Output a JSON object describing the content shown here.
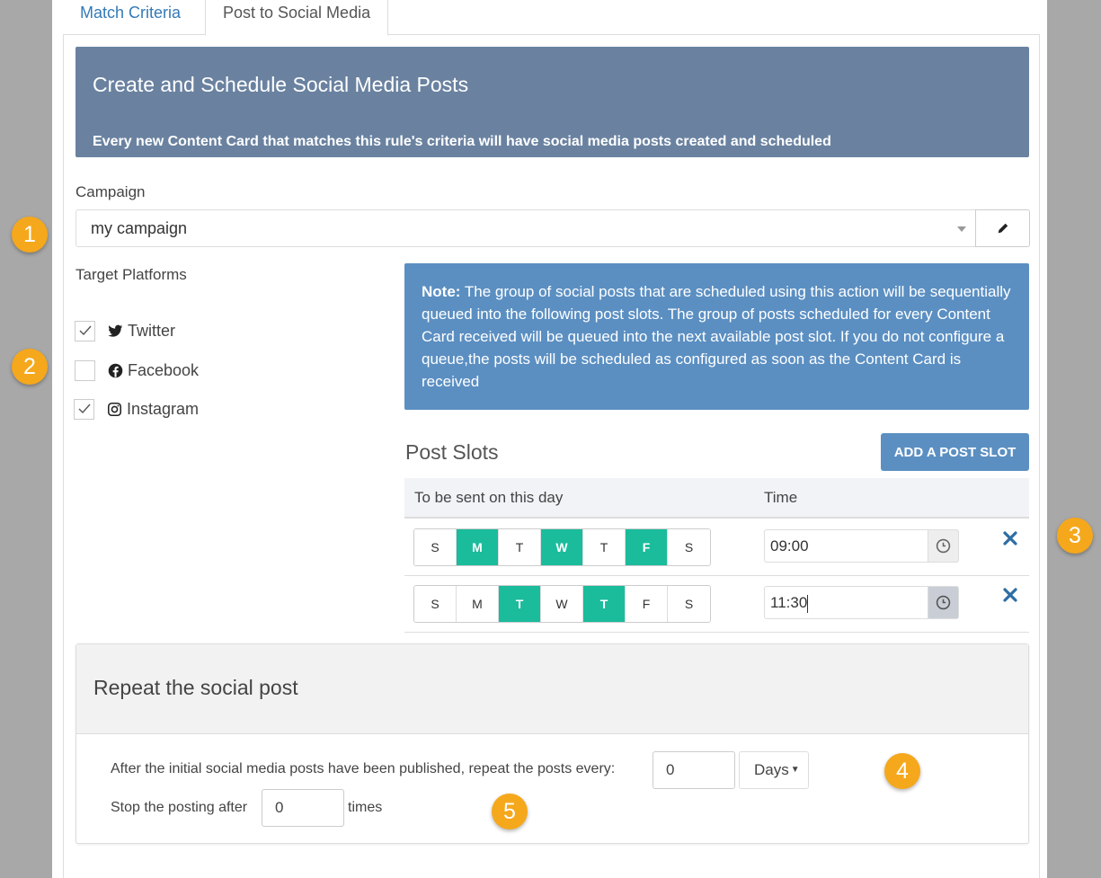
{
  "tabs": [
    {
      "label": "Match Criteria",
      "active": false
    },
    {
      "label": "Post to Social Media",
      "active": true
    }
  ],
  "banner": {
    "title": "Create and Schedule Social Media Posts",
    "subtitle": "Every new Content Card that matches this rule's criteria will have social media posts created and scheduled"
  },
  "campaign": {
    "label": "Campaign",
    "value": "my campaign"
  },
  "platforms": {
    "label": "Target Platforms",
    "items": [
      {
        "name": "Twitter",
        "checked": true,
        "icon": "twitter-icon"
      },
      {
        "name": "Facebook",
        "checked": false,
        "icon": "facebook-icon"
      },
      {
        "name": "Instagram",
        "checked": true,
        "icon": "instagram-icon"
      }
    ]
  },
  "note": {
    "prefix": "Note:",
    "text": " The group of social posts that are scheduled using this action will be sequentially queued into the following post slots. The group of posts scheduled for every Content Card received will be queued into the next available post slot. If you do not configure a queue,the posts will be scheduled as configured as soon as the Content Card is received"
  },
  "post_slots": {
    "title": "Post Slots",
    "add_label": "ADD A POST SLOT",
    "col_day": "To be sent on this day",
    "col_time": "Time",
    "rows": [
      {
        "days": [
          "S",
          "M",
          "T",
          "W",
          "T",
          "F",
          "S"
        ],
        "selected": [
          false,
          true,
          false,
          true,
          false,
          true,
          false
        ],
        "time": "09:00"
      },
      {
        "days": [
          "S",
          "M",
          "T",
          "W",
          "T",
          "F",
          "S"
        ],
        "selected": [
          false,
          false,
          true,
          false,
          true,
          false,
          false
        ],
        "time": "11:30"
      }
    ]
  },
  "repeat": {
    "title": "Repeat the social post",
    "repeat_text": "After the initial social media posts have been published, repeat the posts every:",
    "repeat_value": "0",
    "unit": "Days",
    "stop_text": "Stop the posting after",
    "stop_value": "0",
    "times_text": "times"
  },
  "markers": [
    "1",
    "2",
    "3",
    "4",
    "5"
  ],
  "colors": {
    "banner": "#6a82a0",
    "note": "#5b8fc2",
    "day_selected": "#1abc9c",
    "delete": "#337ab7",
    "marker": "#f5a81c"
  }
}
